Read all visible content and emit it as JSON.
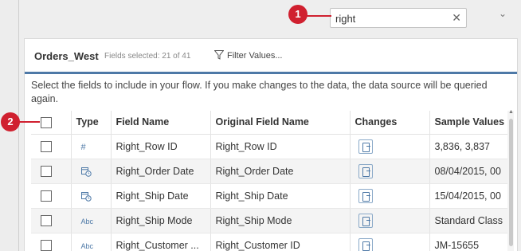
{
  "search": {
    "value": "right",
    "clear_icon": "✕"
  },
  "collapse_icon": "⌄",
  "callouts": [
    "1",
    "2"
  ],
  "source": {
    "name": "Orders_West",
    "fields_selected": "Fields selected: 21 of 41",
    "filter_label": "Filter Values..."
  },
  "info_text": "Select the fields to include in your flow. If you make changes to the data, the data source will be queried again.",
  "table": {
    "headers": [
      "Type",
      "Field Name",
      "Original Field Name",
      "Changes",
      "Sample Values"
    ],
    "rows": [
      {
        "type_icon": "#",
        "field_name": "Right_Row ID",
        "original_name": "Right_Row ID",
        "sample": "3,836, 3,837"
      },
      {
        "type_icon": "date-time-icon",
        "field_name": "Right_Order Date",
        "original_name": "Right_Order Date",
        "sample": "08/04/2015, 00"
      },
      {
        "type_icon": "date-time-icon",
        "field_name": "Right_Ship Date",
        "original_name": "Right_Ship Date",
        "sample": "15/04/2015, 00"
      },
      {
        "type_icon": "Abc",
        "field_name": "Right_Ship Mode",
        "original_name": "Right_Ship Mode",
        "sample": "Standard Class"
      },
      {
        "type_icon": "Abc",
        "field_name": "Right_Customer ...",
        "original_name": "Right_Customer ID",
        "sample": "JM-15655"
      }
    ]
  },
  "colors": {
    "accent": "#4e79a7",
    "callout": "#d0202f"
  }
}
